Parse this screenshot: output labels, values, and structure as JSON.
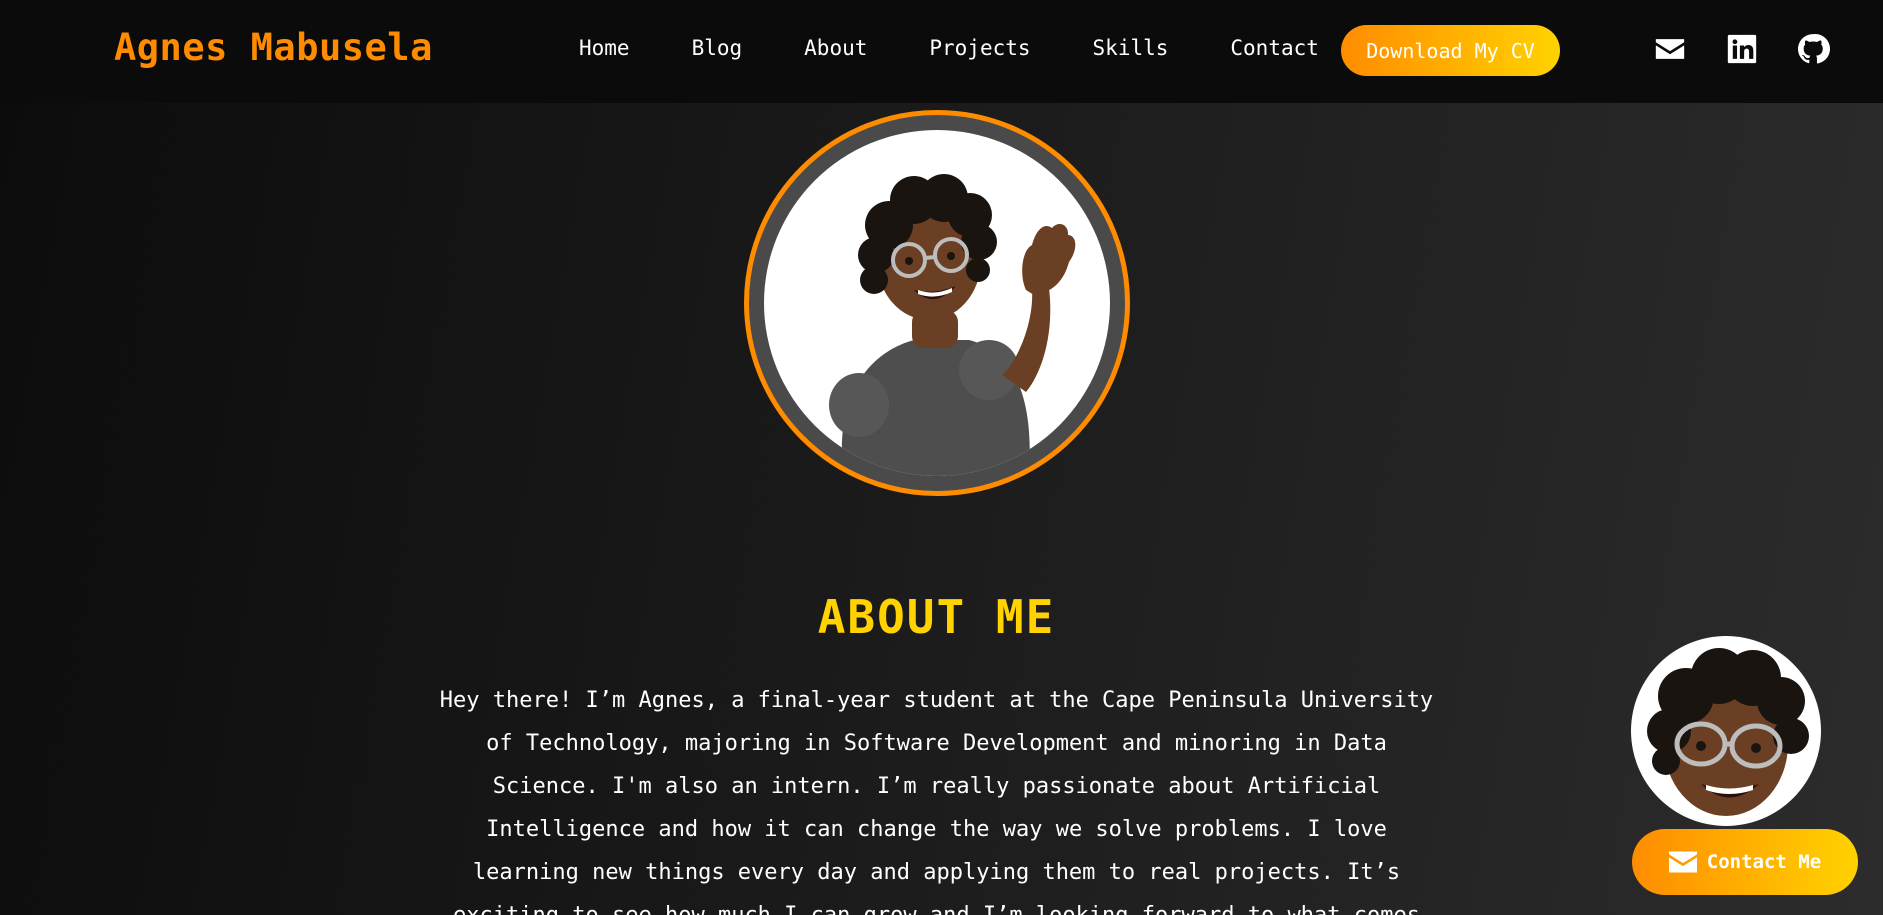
{
  "header": {
    "brand": "Agnes Mabusela",
    "nav": [
      "Home",
      "Blog",
      "About",
      "Projects",
      "Skills",
      "Contact"
    ],
    "cv_button": "Download My CV",
    "social_icons": [
      "envelope-icon",
      "linkedin-icon",
      "github-icon"
    ]
  },
  "about": {
    "heading": "ABOUT ME",
    "text": "Hey there! I’m Agnes, a final-year student at the Cape Peninsula University of Technology, majoring in Software Development and minoring in Data Science. I'm also an intern. I’m really passionate about Artificial Intelligence and how it can change the way we solve problems. I love learning new things every day and applying them to real projects. It’s exciting to see how much I can grow and I’m looking forward to what comes"
  },
  "floating": {
    "contact_label": "Contact Me"
  },
  "colors": {
    "accent_orange": "#ff8c00",
    "accent_yellow": "#ffd200",
    "navbar_bg": "#0b0b0b"
  }
}
